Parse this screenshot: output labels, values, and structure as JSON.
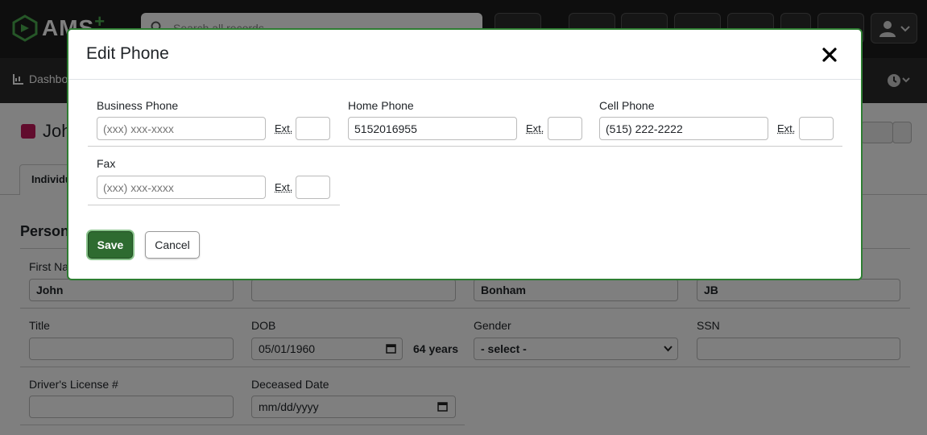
{
  "app": {
    "logo_text": "AMS",
    "logo_plus": "+"
  },
  "search": {
    "placeholder": "Search all records"
  },
  "subnav": {
    "dashboard_label": "Dashbo"
  },
  "record": {
    "name": "Joh",
    "tab_label": "Individu"
  },
  "colors": {
    "accent": "#2e7d32",
    "name_badge": "#c2185b"
  },
  "background_form": {
    "section_title": "Persona",
    "first_name_label": "First Na",
    "first_name_value": "John",
    "middle_value": "",
    "last_name_value": "Bonham",
    "nickname_value": "JB",
    "title_label": "Title",
    "dob_label": "DOB",
    "dob_value": "05/01/1960",
    "age_value": "64 years",
    "gender_label": "Gender",
    "gender_value": "- select -",
    "ssn_label": "SSN",
    "license_label": "Driver's License #",
    "deceased_label": "Deceased Date",
    "deceased_placeholder": "mm/dd/yyyy"
  },
  "modal": {
    "title": "Edit Phone",
    "ext_label": "Ext.",
    "fields": [
      {
        "label": "Business Phone",
        "value": "",
        "placeholder": "(xxx) xxx-xxxx"
      },
      {
        "label": "Home Phone",
        "value": "5152016955",
        "placeholder": "(xxx) xxx-xxxx"
      },
      {
        "label": "Cell Phone",
        "value": "(515) 222-2222",
        "placeholder": "(xxx) xxx-xxxx"
      },
      {
        "label": "Fax",
        "value": "",
        "placeholder": "(xxx) xxx-xxxx"
      }
    ],
    "save_label": "Save",
    "cancel_label": "Cancel"
  }
}
